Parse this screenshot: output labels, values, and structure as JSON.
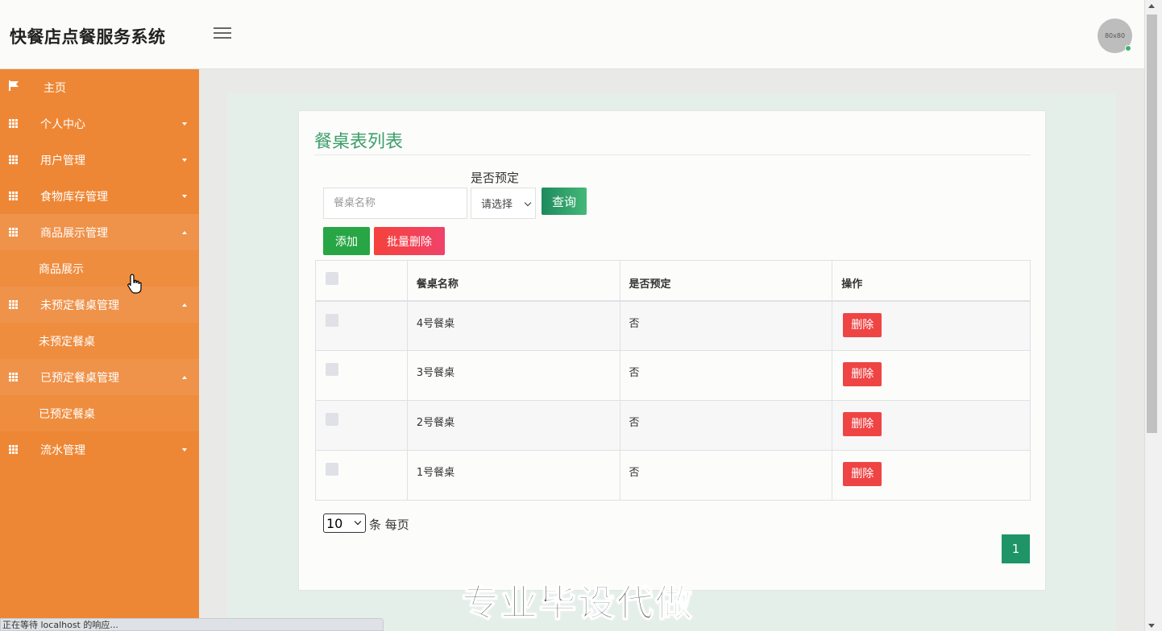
{
  "header": {
    "app_title": "快餐店点餐服务系统",
    "avatar_text": "80x80"
  },
  "sidebar": {
    "items": [
      {
        "label": "主页",
        "icon": "flag-icon"
      },
      {
        "label": "个人中心",
        "icon": "grid-icon",
        "caret": "down"
      },
      {
        "label": "用户管理",
        "icon": "grid-icon",
        "caret": "down"
      },
      {
        "label": "食物库存管理",
        "icon": "grid-icon",
        "caret": "down"
      },
      {
        "label": "商品展示管理",
        "icon": "grid-icon",
        "caret": "up",
        "sub": "商品展示"
      },
      {
        "label": "未预定餐桌管理",
        "icon": "grid-icon",
        "caret": "up",
        "sub": "未预定餐桌"
      },
      {
        "label": "已预定餐桌管理",
        "icon": "grid-icon",
        "caret": "up",
        "sub": "已预定餐桌"
      },
      {
        "label": "流水管理",
        "icon": "grid-icon",
        "caret": "down"
      }
    ]
  },
  "main": {
    "title": "餐桌表列表",
    "search": {
      "name_placeholder": "餐桌名称",
      "reserved_label": "是否预定",
      "reserved_select": "请选择",
      "query_label": "查询"
    },
    "actions": {
      "add_label": "添加",
      "batch_delete_label": "批量删除"
    },
    "table": {
      "headers": [
        "",
        "餐桌名称",
        "是否预定",
        "操作"
      ],
      "rows": [
        {
          "name": "4号餐桌",
          "reserved": "否",
          "action": "删除"
        },
        {
          "name": "3号餐桌",
          "reserved": "否",
          "action": "删除"
        },
        {
          "name": "2号餐桌",
          "reserved": "否",
          "action": "删除"
        },
        {
          "name": "1号餐桌",
          "reserved": "否",
          "action": "删除"
        }
      ]
    },
    "pagination": {
      "page_size": "10",
      "per_page_text": "条 每页",
      "current_page": "1"
    }
  },
  "watermark": "专业毕设代做",
  "status_bar": "正在等待 localhost 的响应...",
  "colors": {
    "sidebar": "#ee8735",
    "accent_green": "#3d9e6a",
    "danger": "#ef4444"
  }
}
